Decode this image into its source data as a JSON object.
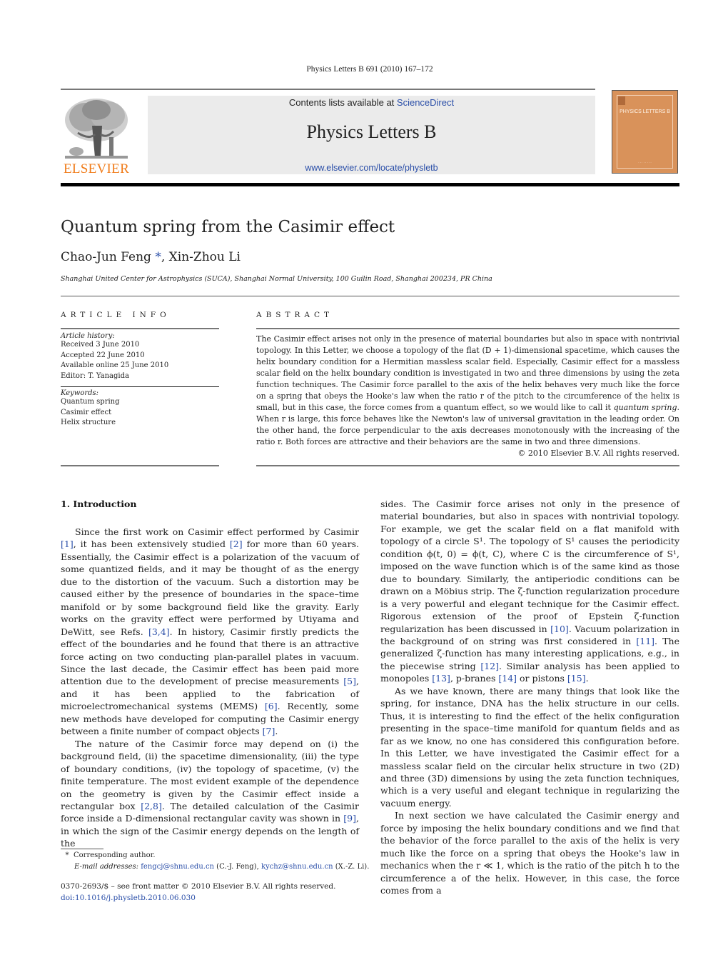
{
  "journal_ref": "Physics Letters B 691 (2010) 167–172",
  "header": {
    "contents_prefix": "Contents lists available at ",
    "contents_link": "ScienceDirect",
    "journal_title": "Physics Letters B",
    "journal_url": "www.elsevier.com/locate/physletb",
    "publisher_logo_text": "ELSEVIER",
    "cover_title": "PHYSICS LETTERS B",
    "colors": {
      "publisher_orange": "#f07c1a",
      "link_blue": "#2a4ea8",
      "cover_orange": "#d9925a",
      "banner_gray": "#ebebeb"
    }
  },
  "article": {
    "title": "Quantum spring from the Casimir effect",
    "author1": "Chao-Jun Feng",
    "author_mark": "*",
    "author_sep": ", ",
    "author2": "Xin-Zhou Li",
    "affiliation": "Shanghai United Center for Astrophysics (SUCA), Shanghai Normal University, 100 Guilin Road, Shanghai 200234, PR China"
  },
  "article_info": {
    "heading": "ARTICLE INFO",
    "history_label": "Article history:",
    "history": [
      "Received 3 June 2010",
      "Accepted 22 June 2010",
      "Available online 25 June 2010",
      "Editor: T. Yanagida"
    ],
    "keywords_label": "Keywords:",
    "keywords": [
      "Quantum spring",
      "Casimir effect",
      "Helix structure"
    ]
  },
  "abstract": {
    "heading": "ABSTRACT",
    "text_1": "The Casimir effect arises not only in the presence of material boundaries but also in space with nontrivial topology. In this Letter, we choose a topology of the flat (D + 1)-dimensional spacetime, which causes the helix boundary condition for a Hermitian massless scalar field. Especially, Casimir effect for a massless scalar field on the helix boundary condition is investigated in two and three dimensions by using the zeta function techniques. The Casimir force parallel to the axis of the helix behaves very much like the force on a spring that obeys the Hooke's law when the ratio r of the pitch to the circumference of the helix is small, but in this case, the force comes from a quantum effect, so we would like to call it ",
    "text_emph": "quantum spring",
    "text_2": ". When r is large, this force behaves like the Newton's law of universal gravitation in the leading order. On the other hand, the force perpendicular to the axis decreases monotonously with the increasing of the ratio r. Both forces are attractive and their behaviors are the same in two and three dimensions.",
    "copyright": "© 2010 Elsevier B.V. All rights reserved."
  },
  "intro": {
    "heading": "1.  Introduction",
    "left_p1": [
      "Since the first work on Casimir effect performed by Casimir ",
      "[1]",
      ", it has been extensively studied ",
      "[2]",
      " for more than 60 years. Essentially, the Casimir effect is a polarization of the vacuum of some quantized fields, and it may be thought of as the energy due to the distortion of the vacuum. Such a distortion may be caused either by the presence of boundaries in the space–time manifold or by some background field like the gravity. Early works on the gravity effect were performed by Utiyama and DeWitt, see Refs. ",
      "[3,4]",
      ". In history, Casimir firstly predicts the effect of the boundaries and he found that there is an attractive force acting on two conducting plan-parallel plates in vacuum. Since the last decade, the Casimir effect has been paid more attention due to the development of precise measurements ",
      "[5]",
      ", and it has been applied to the fabrication of microelectromechanical systems (MEMS) ",
      "[6]",
      ". Recently, some new methods have developed for computing the Casimir energy between a finite number of compact objects ",
      "[7]",
      "."
    ],
    "left_p2": [
      "The nature of the Casimir force may depend on (i) the background field, (ii) the spacetime dimensionality, (iii) the type of boundary conditions, (iv) the topology of spacetime, (v) the finite temperature. The most evident example of the dependence on the geometry is given by the Casimir effect inside a rectangular box ",
      "[2,8]",
      ". The detailed calculation of the Casimir force inside a D-dimensional rectangular cavity was shown in ",
      "[9]",
      ", in which the sign of the Casimir energy depends on the length of the"
    ],
    "right_p1": [
      "sides. The Casimir force arises not only in the presence of material boundaries, but also in spaces with nontrivial topology. For example, we get the scalar field on a flat manifold with topology of a circle S¹. The topology of S¹ causes the periodicity condition ϕ(t, 0) = ϕ(t, C), where C is the circumference of S¹, imposed on the wave function which is of the same kind as those due to boundary. Similarly, the antiperiodic conditions can be drawn on a Möbius strip. The ζ-function regularization procedure is a very powerful and elegant technique for the Casimir effect. Rigorous extension of the proof of Epstein ζ-function regularization has been discussed in ",
      "[10]",
      ". Vacuum polarization in the background of on string was first considered in ",
      "[11]",
      ". The generalized ζ-function has many interesting applications, e.g., in the piecewise string ",
      "[12]",
      ". Similar analysis has been applied to monopoles ",
      "[13]",
      ", p-branes ",
      "[14]",
      " or pistons ",
      "[15]",
      "."
    ],
    "right_p2": "As we have known, there are many things that look like the spring, for instance, DNA has the helix structure in our cells. Thus, it is interesting to find the effect of the helix configuration presenting in the space–time manifold for quantum fields and as far as we know, no one has considered this configuration before. In this Letter, we have investigated the Casimir effect for a massless scalar field on the circular helix structure in two (2D) and three (3D) dimensions by using the zeta function techniques, which is a very useful and elegant technique in regularizing the vacuum energy.",
    "right_p3": "In next section we have calculated the Casimir energy and force by imposing the helix boundary conditions and we find that the behavior of the force parallel to the axis of the helix is very much like the force on a spring that obeys the Hooke's law in mechanics when the r ≪ 1, which is the ratio of the pitch h to the circumference a of the helix. However, in this case, the force comes from a"
  },
  "footnote": {
    "mark": "*",
    "corresponding": "Corresponding author.",
    "email_label": "E-mail addresses: ",
    "email1": "fengcj@shnu.edu.cn",
    "email1_who": " (C.-J. Feng), ",
    "email2": "kychz@shnu.edu.cn",
    "email2_who": " (X.-Z. Li)."
  },
  "front_matter": {
    "issn_line": "0370-2693/$ – see front matter  © 2010 Elsevier B.V. All rights reserved.",
    "doi": "doi:10.1016/j.physletb.2010.06.030"
  }
}
